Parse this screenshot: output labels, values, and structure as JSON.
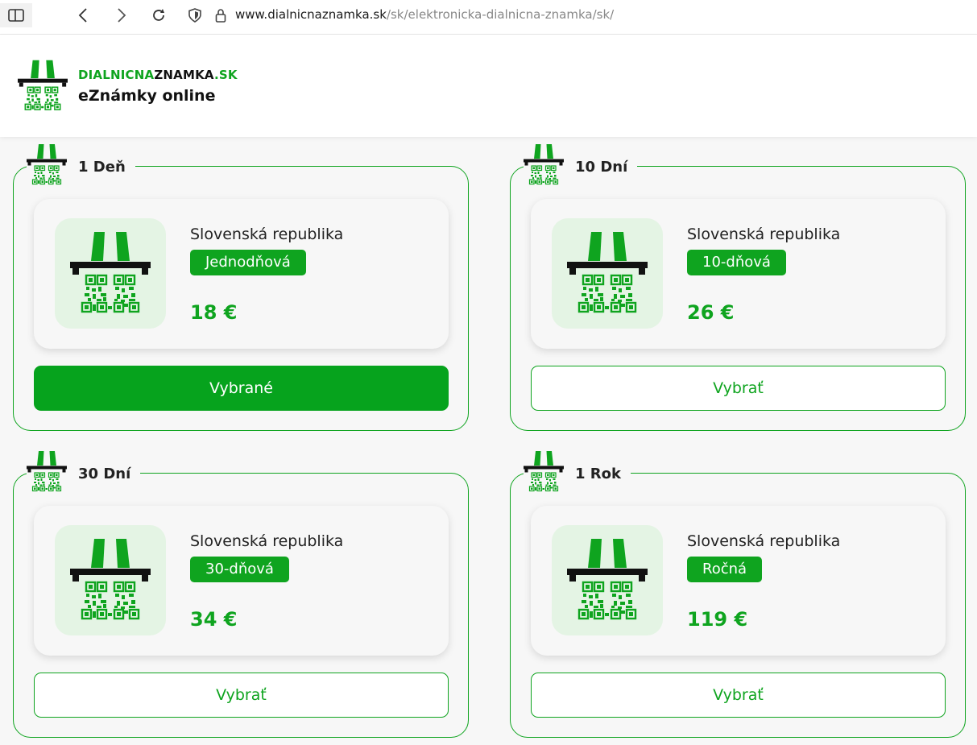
{
  "browser": {
    "url_host": "www.dialnicnaznamka.sk",
    "url_path": "/sk/elektronicka-dialnicna-znamka/sk/"
  },
  "header": {
    "brand_green": "DIALNICNA",
    "brand_black": "ZNAMKA",
    "brand_tld": ".SK",
    "tagline": "eZnámky online"
  },
  "colors": {
    "accent": "#0fa41f",
    "thumb_bg": "#e4f4e4"
  },
  "products": [
    {
      "period": "1 Deň",
      "country": "Slovenská republika",
      "type": "Jednodňová",
      "price": "18 €",
      "button": "Vybrané",
      "selected": true
    },
    {
      "period": "10 Dní",
      "country": "Slovenská republika",
      "type": "10-dňová",
      "price": "26 €",
      "button": "Vybrať",
      "selected": false
    },
    {
      "period": "30 Dní",
      "country": "Slovenská republika",
      "type": "30-dňová",
      "price": "34 €",
      "button": "Vybrať",
      "selected": false
    },
    {
      "period": "1 Rok",
      "country": "Slovenská republika",
      "type": "Ročná",
      "price": "119 €",
      "button": "Vybrať",
      "selected": false
    }
  ]
}
